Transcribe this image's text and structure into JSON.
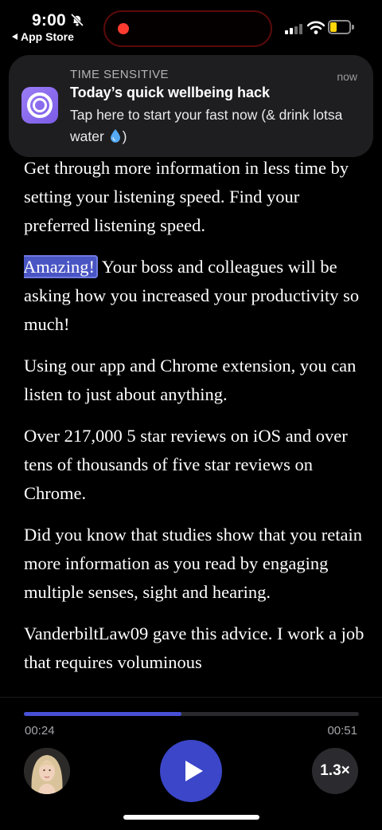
{
  "status_bar": {
    "time": "9:00",
    "back_label": "App Store",
    "icons": [
      "bell-slash-icon",
      "record-dot-icon",
      "cellular-signal-icon",
      "wifi-icon",
      "battery-icon"
    ],
    "battery_level": 0.35,
    "battery_color": "#ffd60a",
    "record_color": "#ff3b30"
  },
  "notification": {
    "header": "TIME SENSITIVE",
    "time": "now",
    "title": "Today’s quick wellbeing hack",
    "body_before": "Tap here to start your fast now (& drink lotsa water",
    "body_after": ")",
    "icon": "app-ring-icon",
    "emoji": "droplet-icon"
  },
  "article": {
    "paragraphs": [
      "Get through more information in less time by setting your listening speed. Find your preferred listening speed.",
      "Your boss and colleagues will be asking how you increased your productivity so much!",
      "Using our app and Chrome extension, you can listen to just about anything.",
      "Over 217,000 5 star reviews on iOS and over tens of thousands of five star reviews on Chrome.",
      "Did you know that studies show that you retain more information as you read by engaging multiple senses, sight and hearing.",
      "VanderbiltLaw09 gave this advice. I work a job that requires voluminous"
    ],
    "highlighted_word": "Amazing!",
    "highlight_color": "#4a55c4"
  },
  "player": {
    "elapsed": "00:24",
    "total": "00:51",
    "progress": 0.47,
    "speed_label": "1.3×",
    "accent": "#3b46c8",
    "voice_avatar": "avatar",
    "play_icon": "play-icon"
  }
}
